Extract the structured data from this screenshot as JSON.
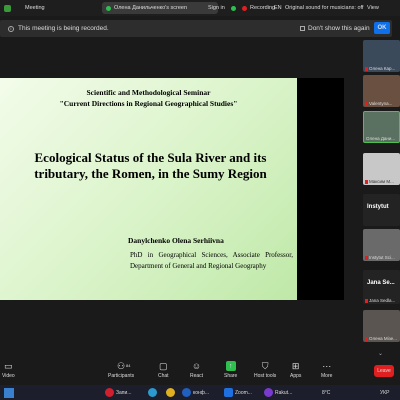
{
  "topbar": {
    "app_label": "Meeting",
    "tab_label": "Олена Данильченко's screen",
    "signin": "Sign in",
    "recording": "Recording",
    "lang": "EN",
    "original_sound": "Original sound for musicians: off",
    "view": "View"
  },
  "notice": {
    "text": "This meeting is being recorded.",
    "checkbox_label": "Don't show this again",
    "ok": "OK"
  },
  "slide": {
    "seminar_line1": "Scientific and Methodological Seminar",
    "seminar_line2": "\"Current Directions in Regional Geographical Studies\"",
    "title": "Ecological Status of the Sula River and its tributary, the Romen, in the Sumy Region",
    "author": "Danylchenko Olena Serhiivna",
    "bio": "PhD in Geographical Sciences, Associate Professor, Department of General and Regional Geography"
  },
  "participants": [
    {
      "name": "Олена Кар...",
      "type": "video"
    },
    {
      "name": "Valentyna...",
      "type": "video"
    },
    {
      "name": "Олена Дани...",
      "type": "video"
    },
    {
      "name": "Maксим М...",
      "type": "video"
    },
    {
      "name": "Instytut",
      "type": "tile"
    },
    {
      "name": "Instytut Sci...",
      "type": "video"
    },
    {
      "name": "Jana Se...",
      "type": "tile"
    },
    {
      "name": "Jana Sedla...",
      "type": "tile"
    },
    {
      "name": "Олена Мізе...",
      "type": "video"
    }
  ],
  "controls": {
    "video": "Video",
    "participants": "Participants",
    "participants_count": "84",
    "chat": "Chat",
    "react": "React",
    "share": "Share",
    "host_tools": "Host tools",
    "apps": "Apps",
    "more": "More",
    "leave": "Leave"
  },
  "taskbar": {
    "item1": "Запи...",
    "item2": "конф...",
    "item3": "Zoom...",
    "item4": "Rakut...",
    "temp": "8°C",
    "lang": "УКР"
  }
}
